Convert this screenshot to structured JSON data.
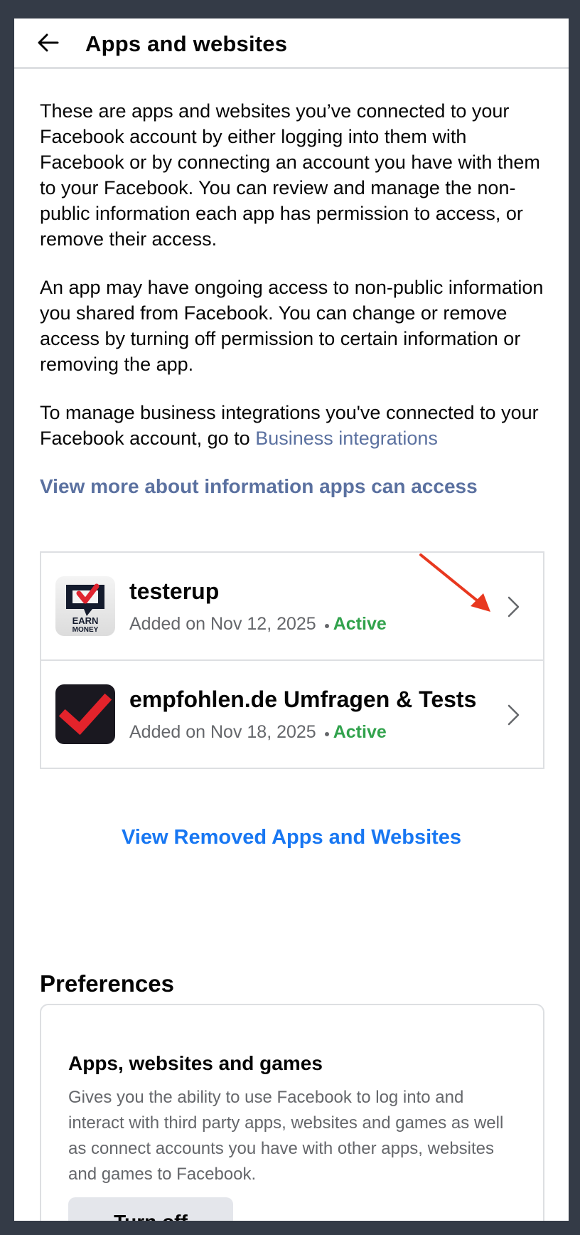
{
  "header": {
    "title": "Apps and websites"
  },
  "intro": {
    "para1": "These are apps and websites you’ve connected to your Facebook account by either logging into them with Facebook or by connecting an account you have with them to your Facebook. You can review and manage the non-public information each app has permission to access, or remove their access.",
    "para2": "An app may have ongoing access to non-public information you shared from Facebook. You can change or remove access by turning off permission to certain information or removing the app.",
    "para3_prefix": "To manage business integrations you've connected to your Facebook account, go to ",
    "para3_link": "Business integrations",
    "more_link": "View more about information apps can access"
  },
  "apps": [
    {
      "name": "testerup",
      "added": "Added on Nov 12, 2025",
      "status": "Active",
      "logo_text_1": "EARN",
      "logo_text_2": "MONEY"
    },
    {
      "name": "empfohlen.de Umfragen & Tests",
      "added": "Added on Nov 18, 2025",
      "status": "Active"
    }
  ],
  "removed_link": "View Removed Apps and Websites",
  "preferences": {
    "heading": "Preferences",
    "card_title": "Apps, websites and games",
    "card_desc": "Gives you the ability to use Facebook to log into and interact with third party apps, websites and games as well as connect accounts you have with other apps, websites and games to Facebook.",
    "button_label": "Turn off"
  },
  "colors": {
    "link": "#5b71a0",
    "primary": "#1877f2",
    "active": "#31a24c",
    "annotation_arrow": "#e8381f"
  }
}
